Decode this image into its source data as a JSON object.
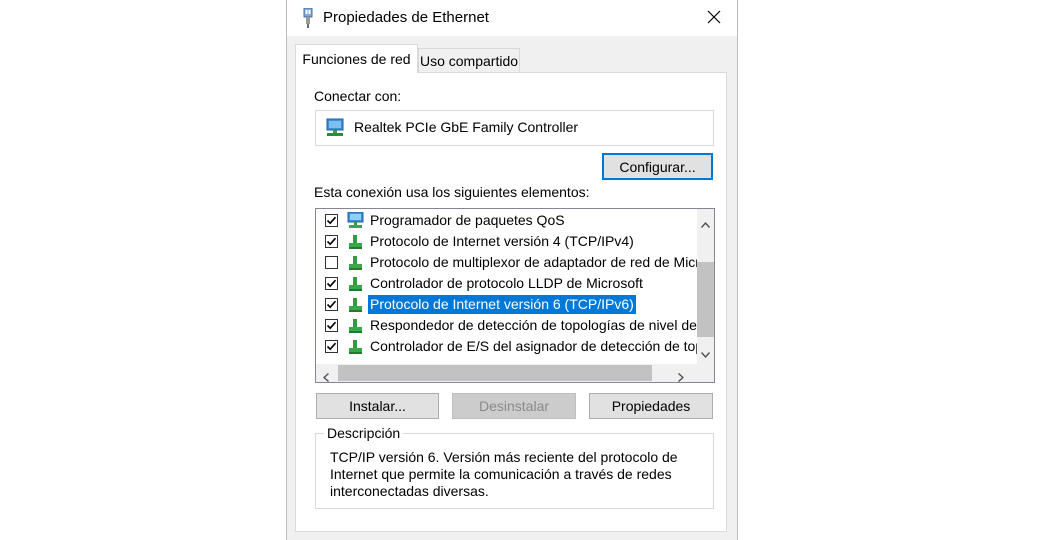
{
  "window": {
    "title": "Propiedades de Ethernet",
    "icon": "network-adapter-icon"
  },
  "tabs": [
    {
      "label": "Funciones de red",
      "active": true
    },
    {
      "label": "Uso compartido",
      "active": false
    }
  ],
  "connect": {
    "label": "Conectar con:",
    "adapter_name": "Realtek PCIe GbE Family Controller",
    "configure_label": "Configurar..."
  },
  "elements": {
    "label": "Esta conexión usa los siguientes elementos:",
    "items": [
      {
        "checked": true,
        "icon": "qos-icon",
        "text": "Programador de paquetes QoS",
        "selected": false
      },
      {
        "checked": true,
        "icon": "protocol-icon",
        "text": "Protocolo de Internet versión 4 (TCP/IPv4)",
        "selected": false
      },
      {
        "checked": false,
        "icon": "protocol-icon",
        "text": "Protocolo de multiplexor de adaptador de red de Micros",
        "selected": false
      },
      {
        "checked": true,
        "icon": "protocol-icon",
        "text": "Controlador de protocolo LLDP de Microsoft",
        "selected": false
      },
      {
        "checked": true,
        "icon": "protocol-icon",
        "text": "Protocolo de Internet versión 6 (TCP/IPv6)",
        "selected": true
      },
      {
        "checked": true,
        "icon": "protocol-icon",
        "text": "Respondedor de detección de topologías de nivel de v",
        "selected": false
      },
      {
        "checked": true,
        "icon": "protocol-icon",
        "text": "Controlador de E/S del asignador de detección de topc",
        "selected": false
      }
    ]
  },
  "buttons": {
    "install": "Instalar...",
    "uninstall": "Desinstalar",
    "properties": "Propiedades"
  },
  "description": {
    "legend": "Descripción",
    "lines": [
      "TCP/IP versión 6. Versión más reciente del protocolo de",
      "Internet que permite la comunicación a través de redes",
      "interconectadas diversas."
    ]
  },
  "colors": {
    "selection": "#0078d7",
    "dialog_bg": "#f0f0f0"
  }
}
